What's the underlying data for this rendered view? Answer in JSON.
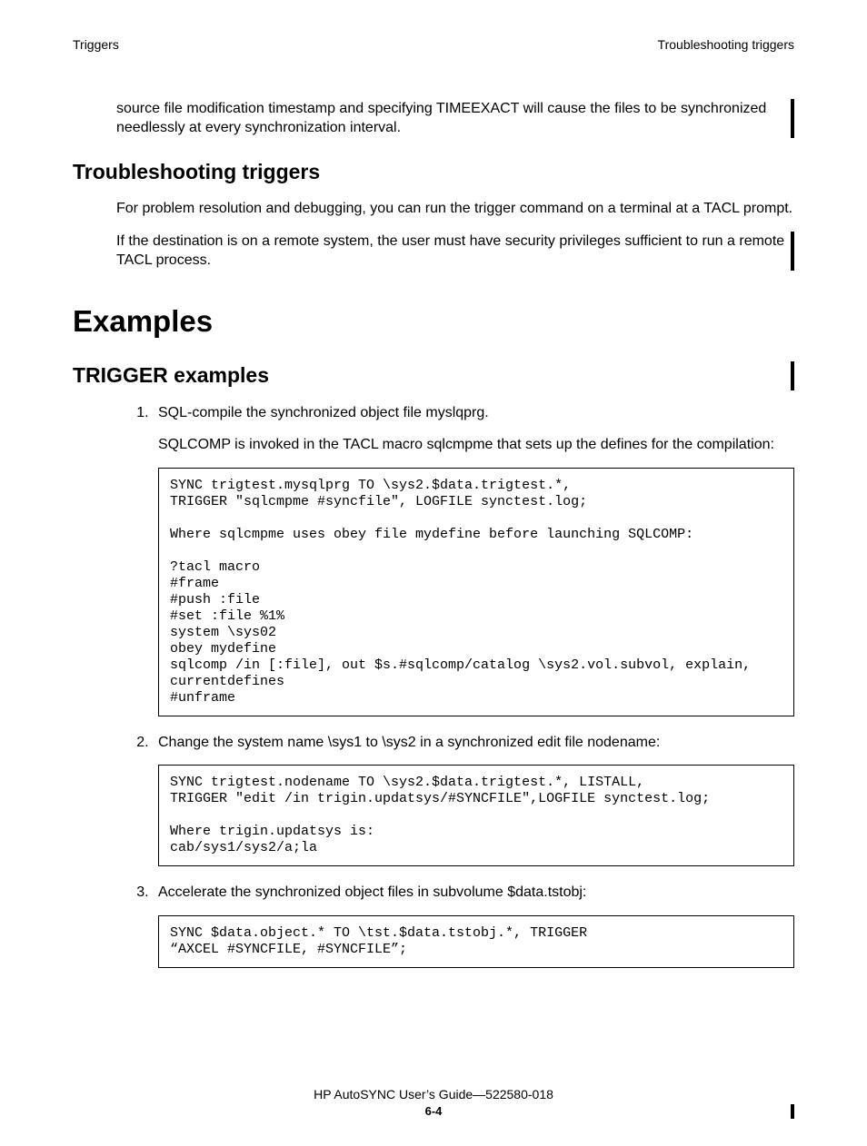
{
  "header": {
    "left": "Triggers",
    "right": "Troubleshooting triggers"
  },
  "intro": "source file modification timestamp and specifying TIMEEXACT will cause the files to be synchronized needlessly at every synchronization interval.",
  "sect_troubleshoot": {
    "heading": "Troubleshooting triggers",
    "p1": "For problem resolution and debugging, you can run the trigger command on a terminal at a TACL prompt.",
    "p2": "If the destination is on a remote system, the user must have security privileges sufficient to run a remote TACL process."
  },
  "sect_examples": {
    "heading": "Examples",
    "sub_heading": "TRIGGER examples",
    "items": [
      {
        "lead": "SQL-compile the synchronized object file myslqprg.",
        "p2": "SQLCOMP is invoked in the TACL macro sqlcmpme that sets up the defines for the compilation:",
        "code": "SYNC trigtest.mysqlprg TO \\sys2.$data.trigtest.*,\nTRIGGER \"sqlcmpme #syncfile\", LOGFILE synctest.log;\n\nWhere sqlcmpme uses obey file mydefine before launching SQLCOMP:\n\n?tacl macro\n#frame\n#push :file\n#set :file %1%\nsystem \\sys02\nobey mydefine\nsqlcomp /in [:file], out $s.#sqlcomp/catalog \\sys2.vol.subvol, explain, currentdefines\n#unframe"
      },
      {
        "lead": "Change the system name \\sys1 to \\sys2 in a synchronized edit file nodename:",
        "code": "SYNC trigtest.nodename TO \\sys2.$data.trigtest.*, LISTALL,\nTRIGGER \"edit /in trigin.updatsys/#SYNCFILE\",LOGFILE synctest.log;\n\nWhere trigin.updatsys is:\ncab/sys1/sys2/a;la"
      },
      {
        "lead": "Accelerate the synchronized object files in subvolume $data.tstobj:",
        "code": "SYNC $data.object.* TO \\tst.$data.tstobj.*, TRIGGER\n“AXCEL #SYNCFILE, #SYNCFILE”;"
      }
    ]
  },
  "footer": {
    "line1": "HP AutoSYNC User’s Guide—522580-018",
    "line2": "6-4"
  }
}
